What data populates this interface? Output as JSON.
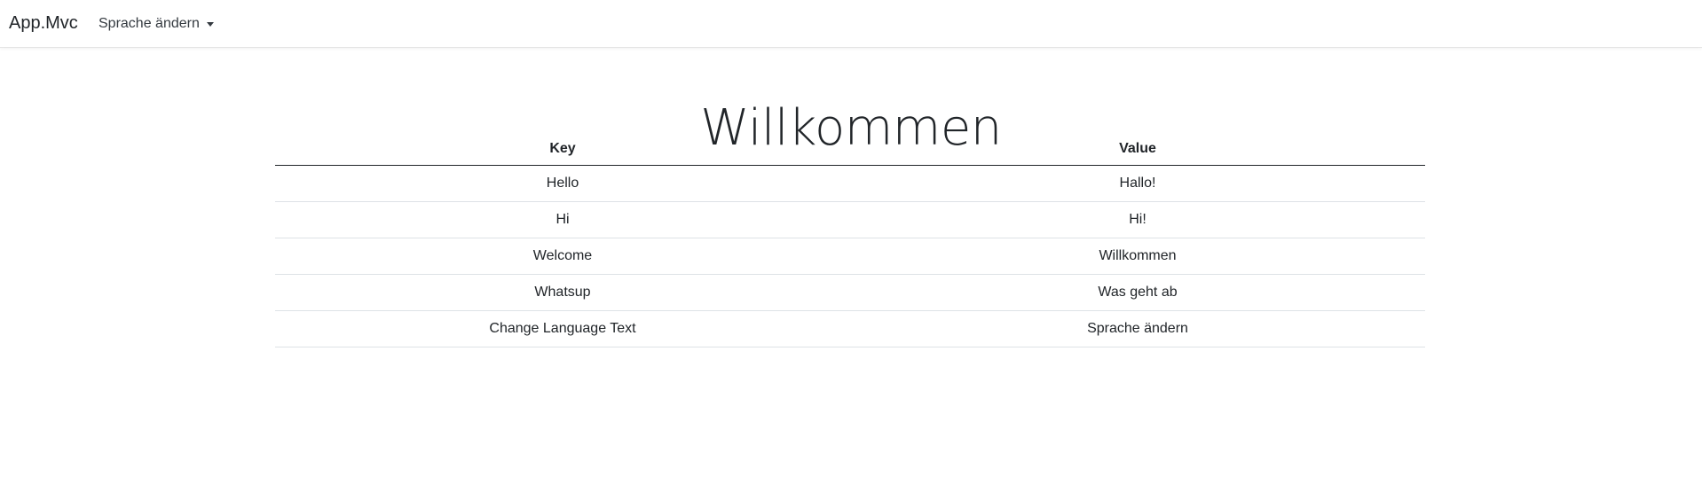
{
  "navbar": {
    "brand": "App.Mvc",
    "language_menu": "Sprache ändern"
  },
  "main": {
    "title": "Willkommen",
    "table": {
      "headers": [
        "Key",
        "Value"
      ],
      "rows": [
        [
          "Hello",
          "Hallo!"
        ],
        [
          "Hi",
          "Hi!"
        ],
        [
          "Welcome",
          "Willkommen"
        ],
        [
          "Whatsup",
          "Was geht ab"
        ],
        [
          "Change Language Text",
          "Sprache ändern"
        ]
      ]
    }
  },
  "icons": {
    "dropdown_caret": "chevron-down-icon"
  }
}
